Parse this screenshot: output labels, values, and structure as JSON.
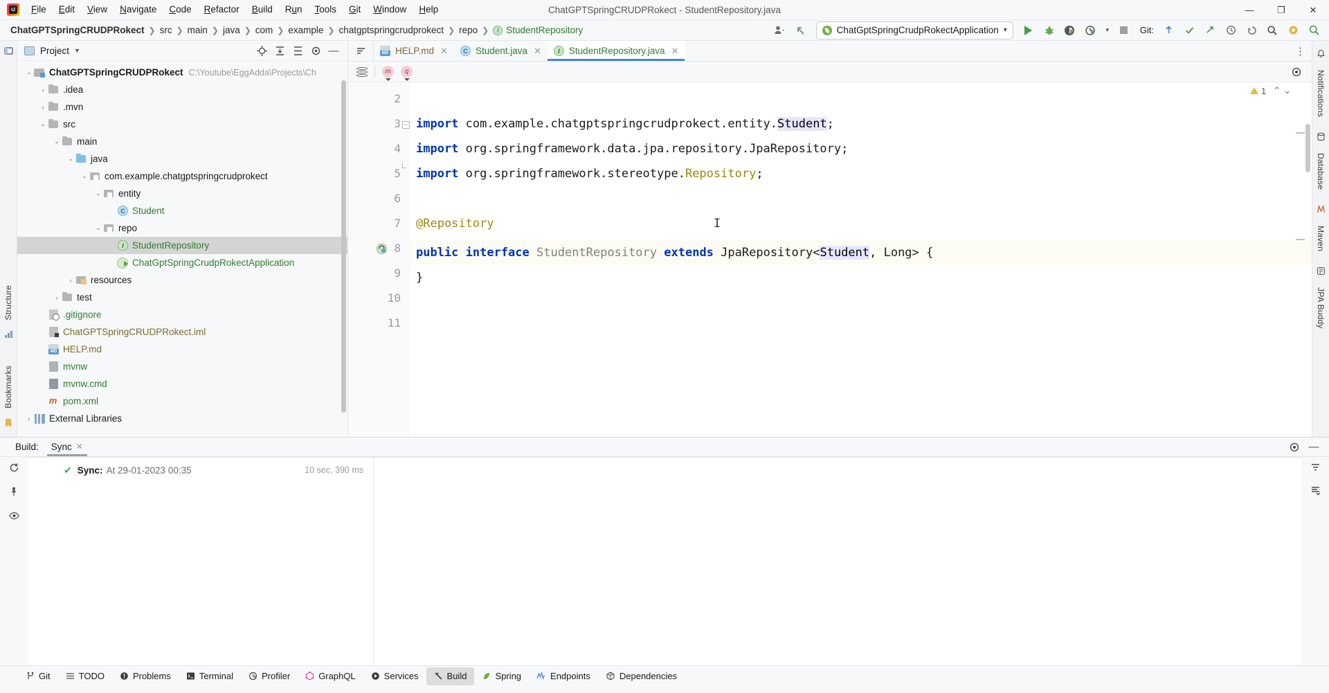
{
  "window": {
    "title": "ChatGPTSpringCRUDPRokect - StudentRepository.java",
    "logo": "intellij-idea-logo",
    "minimize": "—",
    "maximize": "❐",
    "close": "✕"
  },
  "menu": [
    {
      "label": "File"
    },
    {
      "label": "Edit"
    },
    {
      "label": "View"
    },
    {
      "label": "Navigate"
    },
    {
      "label": "Code"
    },
    {
      "label": "Refactor"
    },
    {
      "label": "Build"
    },
    {
      "label": "Run"
    },
    {
      "label": "Tools"
    },
    {
      "label": "Git"
    },
    {
      "label": "Window"
    },
    {
      "label": "Help"
    }
  ],
  "breadcrumbs": [
    {
      "label": "ChatGPTSpringCRUDPRokect",
      "kind": "root"
    },
    {
      "label": "src",
      "kind": "dir"
    },
    {
      "label": "main",
      "kind": "dir"
    },
    {
      "label": "java",
      "kind": "dir"
    },
    {
      "label": "com",
      "kind": "dir"
    },
    {
      "label": "example",
      "kind": "dir"
    },
    {
      "label": "chatgptspringcrudprokect",
      "kind": "dir"
    },
    {
      "label": "repo",
      "kind": "dir"
    },
    {
      "label": "StudentRepository",
      "kind": "interface"
    }
  ],
  "toolbar": {
    "run_config": "ChatGptSpringCrudpRokectApplication",
    "run_config_dropdown": "▾",
    "git_label": "Git:",
    "search_icon": "magnifier-icon",
    "run_icon": "run-triangle-icon",
    "debug_icon": "debug-bug-icon",
    "coverage_icon": "run-with-coverage-icon",
    "profiler_icon": "profiler-clock-icon",
    "stop_icon": "stop-square-icon",
    "update_icon": "update-project-icon",
    "commit_icon": "commit-checkmark-icon",
    "push_icon": "push-arrow-icon",
    "history_icon": "history-clock-icon",
    "undo_icon": "undo-arrow-icon",
    "settings_icon": "settings-gear-icon",
    "account_icon": "account-icon",
    "back_arrow_icon": "back-arrow-icon"
  },
  "sidebar": {
    "title": "Project",
    "actions": [
      "locate-icon",
      "expand-all-icon",
      "collapse-all-icon",
      "settings-gear-icon",
      "hide-icon"
    ],
    "tree": [
      {
        "label": "ChatGPTSpringCRUDPRokect",
        "path": "C:\\Youtube\\EggAdda\\Projects\\Ch",
        "indent": 0,
        "arrow": "⌄",
        "icon": "project-folder",
        "bold": true,
        "color": "dark"
      },
      {
        "label": ".idea",
        "indent": 1,
        "arrow": "›",
        "icon": "folder-gray",
        "color": "dark"
      },
      {
        "label": ".mvn",
        "indent": 1,
        "arrow": "›",
        "icon": "folder-gray",
        "color": "dark"
      },
      {
        "label": "src",
        "indent": 1,
        "arrow": "⌄",
        "icon": "folder-gray",
        "color": "dark"
      },
      {
        "label": "main",
        "indent": 2,
        "arrow": "⌄",
        "icon": "folder-gray",
        "color": "dark"
      },
      {
        "label": "java",
        "indent": 3,
        "arrow": "⌄",
        "icon": "folder-blue",
        "color": "dark"
      },
      {
        "label": "com.example.chatgptspringcrudprokect",
        "indent": 4,
        "arrow": "⌄",
        "icon": "folder-package",
        "color": "dark"
      },
      {
        "label": "entity",
        "indent": 5,
        "arrow": "⌄",
        "icon": "folder-package",
        "color": "dark"
      },
      {
        "label": "Student",
        "indent": 6,
        "arrow": "",
        "icon": "class-icon",
        "color": "green"
      },
      {
        "label": "repo",
        "indent": 5,
        "arrow": "⌄",
        "icon": "folder-package",
        "color": "dark"
      },
      {
        "label": "StudentRepository",
        "indent": 6,
        "arrow": "",
        "icon": "interface-icon",
        "color": "green",
        "selected": true
      },
      {
        "label": "ChatGptSpringCrudpRokectApplication",
        "indent": 6,
        "arrow": "",
        "icon": "spring-class-icon",
        "color": "green"
      },
      {
        "label": "resources",
        "indent": 3,
        "arrow": "›",
        "icon": "folder-resources",
        "color": "dark"
      },
      {
        "label": "test",
        "indent": 2,
        "arrow": "›",
        "icon": "folder-gray",
        "color": "dark"
      },
      {
        "label": ".gitignore",
        "indent": 1,
        "arrow": "",
        "icon": "gitignore-icon",
        "color": "green"
      },
      {
        "label": "ChatGPTSpringCRUDPRokect.iml",
        "indent": 1,
        "arrow": "",
        "icon": "iml-icon",
        "color": "olive"
      },
      {
        "label": "HELP.md",
        "indent": 1,
        "arrow": "",
        "icon": "markdown-icon",
        "color": "olive"
      },
      {
        "label": "mvnw",
        "indent": 1,
        "arrow": "",
        "icon": "shell-icon",
        "color": "green"
      },
      {
        "label": "mvnw.cmd",
        "indent": 1,
        "arrow": "",
        "icon": "cmd-icon",
        "color": "green"
      },
      {
        "label": "pom.xml",
        "indent": 1,
        "arrow": "",
        "icon": "maven-icon",
        "color": "green"
      },
      {
        "label": "External Libraries",
        "indent": 0,
        "arrow": "›",
        "icon": "libraries-icon",
        "color": "dark"
      }
    ]
  },
  "editor": {
    "tabs": [
      {
        "label": "HELP.md",
        "icon": "markdown-icon",
        "close": "✕",
        "active": false
      },
      {
        "label": "Student.java",
        "icon": "class-icon",
        "close": "✕",
        "active": false
      },
      {
        "label": "StudentRepository.java",
        "icon": "interface-icon",
        "close": "✕",
        "active": true
      }
    ],
    "subtoolbar": {
      "database_icon": "database-icon",
      "pill_m": "m",
      "pill_q": "q",
      "settings_icon": "settings-gear-icon"
    },
    "warning_count": "1",
    "warning_up": "⌃",
    "warning_down": "⌄",
    "lines": [
      {
        "num": "2",
        "text": ""
      },
      {
        "num": "3",
        "text": "import com.example.chatgptspringcrudprokect.entity.Student;"
      },
      {
        "num": "4",
        "text": "import org.springframework.data.jpa.repository.JpaRepository;"
      },
      {
        "num": "5",
        "text": "import org.springframework.stereotype.Repository;"
      },
      {
        "num": "6",
        "text": ""
      },
      {
        "num": "7",
        "text": "@Repository"
      },
      {
        "num": "8",
        "text": "public interface StudentRepository extends JpaRepository<Student, Long> {"
      },
      {
        "num": "9",
        "text": "}"
      },
      {
        "num": "10",
        "text": ""
      },
      {
        "num": "11",
        "text": ""
      }
    ]
  },
  "right_rail": [
    {
      "label": "Notifications",
      "icon": "bell-icon"
    },
    {
      "label": "Database",
      "icon": "database-icon"
    },
    {
      "label": "Maven",
      "icon": "maven-icon"
    },
    {
      "label": "JPA Buddy",
      "icon": "jpa-buddy-icon"
    }
  ],
  "left_rail": [
    {
      "label": "Structure",
      "icon": "structure-icon"
    },
    {
      "label": "Bookmarks",
      "icon": "bookmark-icon"
    }
  ],
  "build_panel": {
    "label": "Build:",
    "tab": "Sync",
    "tab_close": "✕",
    "settings_icon": "settings-gear-icon",
    "hide_icon": "hide-icon",
    "rerun_icon": "rerun-icon",
    "pin_icon": "pin-icon",
    "eye_icon": "eye-icon",
    "filter_icon": "filter-icon",
    "sort_icon": "sort-icon",
    "row": {
      "check": "✔",
      "label": "Sync:",
      "value": "At 29-01-2023 00:35",
      "duration": "10 sec, 390 ms"
    }
  },
  "statusbar": [
    {
      "label": "Git",
      "icon": "git-branch-icon",
      "active": false
    },
    {
      "label": "TODO",
      "icon": "todo-list-icon",
      "active": false
    },
    {
      "label": "Problems",
      "icon": "problems-icon",
      "active": false
    },
    {
      "label": "Terminal",
      "icon": "terminal-icon",
      "active": false
    },
    {
      "label": "Profiler",
      "icon": "profiler-icon",
      "active": false
    },
    {
      "label": "GraphQL",
      "icon": "graphql-icon",
      "active": false
    },
    {
      "label": "Services",
      "icon": "services-icon",
      "active": false
    },
    {
      "label": "Build",
      "icon": "build-hammer-icon",
      "active": true
    },
    {
      "label": "Spring",
      "icon": "spring-leaf-icon",
      "active": false
    },
    {
      "label": "Endpoints",
      "icon": "endpoints-icon",
      "active": false
    },
    {
      "label": "Dependencies",
      "icon": "dependencies-icon",
      "active": false
    }
  ],
  "colors": {
    "accent_blue": "#4585d8",
    "keyword": "#0033b3",
    "annotation": "#9e880d",
    "green_text": "#2d7d2d",
    "selection": "#e6e6ff",
    "caret_line": "#fcfcf4"
  }
}
